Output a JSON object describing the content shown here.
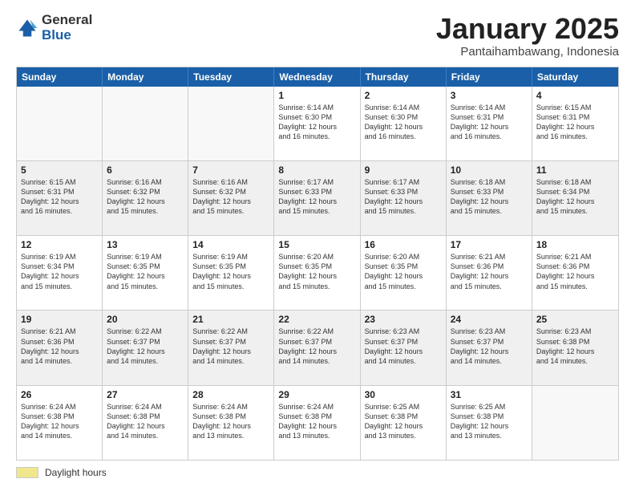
{
  "logo": {
    "general": "General",
    "blue": "Blue"
  },
  "title": "January 2025",
  "subtitle": "Pantaihambawang, Indonesia",
  "days": [
    "Sunday",
    "Monday",
    "Tuesday",
    "Wednesday",
    "Thursday",
    "Friday",
    "Saturday"
  ],
  "weeks": [
    [
      {
        "day": "",
        "info": ""
      },
      {
        "day": "",
        "info": ""
      },
      {
        "day": "",
        "info": ""
      },
      {
        "day": "1",
        "info": "Sunrise: 6:14 AM\nSunset: 6:30 PM\nDaylight: 12 hours\nand 16 minutes."
      },
      {
        "day": "2",
        "info": "Sunrise: 6:14 AM\nSunset: 6:30 PM\nDaylight: 12 hours\nand 16 minutes."
      },
      {
        "day": "3",
        "info": "Sunrise: 6:14 AM\nSunset: 6:31 PM\nDaylight: 12 hours\nand 16 minutes."
      },
      {
        "day": "4",
        "info": "Sunrise: 6:15 AM\nSunset: 6:31 PM\nDaylight: 12 hours\nand 16 minutes."
      }
    ],
    [
      {
        "day": "5",
        "info": "Sunrise: 6:15 AM\nSunset: 6:31 PM\nDaylight: 12 hours\nand 16 minutes."
      },
      {
        "day": "6",
        "info": "Sunrise: 6:16 AM\nSunset: 6:32 PM\nDaylight: 12 hours\nand 15 minutes."
      },
      {
        "day": "7",
        "info": "Sunrise: 6:16 AM\nSunset: 6:32 PM\nDaylight: 12 hours\nand 15 minutes."
      },
      {
        "day": "8",
        "info": "Sunrise: 6:17 AM\nSunset: 6:33 PM\nDaylight: 12 hours\nand 15 minutes."
      },
      {
        "day": "9",
        "info": "Sunrise: 6:17 AM\nSunset: 6:33 PM\nDaylight: 12 hours\nand 15 minutes."
      },
      {
        "day": "10",
        "info": "Sunrise: 6:18 AM\nSunset: 6:33 PM\nDaylight: 12 hours\nand 15 minutes."
      },
      {
        "day": "11",
        "info": "Sunrise: 6:18 AM\nSunset: 6:34 PM\nDaylight: 12 hours\nand 15 minutes."
      }
    ],
    [
      {
        "day": "12",
        "info": "Sunrise: 6:19 AM\nSunset: 6:34 PM\nDaylight: 12 hours\nand 15 minutes."
      },
      {
        "day": "13",
        "info": "Sunrise: 6:19 AM\nSunset: 6:35 PM\nDaylight: 12 hours\nand 15 minutes."
      },
      {
        "day": "14",
        "info": "Sunrise: 6:19 AM\nSunset: 6:35 PM\nDaylight: 12 hours\nand 15 minutes."
      },
      {
        "day": "15",
        "info": "Sunrise: 6:20 AM\nSunset: 6:35 PM\nDaylight: 12 hours\nand 15 minutes."
      },
      {
        "day": "16",
        "info": "Sunrise: 6:20 AM\nSunset: 6:35 PM\nDaylight: 12 hours\nand 15 minutes."
      },
      {
        "day": "17",
        "info": "Sunrise: 6:21 AM\nSunset: 6:36 PM\nDaylight: 12 hours\nand 15 minutes."
      },
      {
        "day": "18",
        "info": "Sunrise: 6:21 AM\nSunset: 6:36 PM\nDaylight: 12 hours\nand 15 minutes."
      }
    ],
    [
      {
        "day": "19",
        "info": "Sunrise: 6:21 AM\nSunset: 6:36 PM\nDaylight: 12 hours\nand 14 minutes."
      },
      {
        "day": "20",
        "info": "Sunrise: 6:22 AM\nSunset: 6:37 PM\nDaylight: 12 hours\nand 14 minutes."
      },
      {
        "day": "21",
        "info": "Sunrise: 6:22 AM\nSunset: 6:37 PM\nDaylight: 12 hours\nand 14 minutes."
      },
      {
        "day": "22",
        "info": "Sunrise: 6:22 AM\nSunset: 6:37 PM\nDaylight: 12 hours\nand 14 minutes."
      },
      {
        "day": "23",
        "info": "Sunrise: 6:23 AM\nSunset: 6:37 PM\nDaylight: 12 hours\nand 14 minutes."
      },
      {
        "day": "24",
        "info": "Sunrise: 6:23 AM\nSunset: 6:37 PM\nDaylight: 12 hours\nand 14 minutes."
      },
      {
        "day": "25",
        "info": "Sunrise: 6:23 AM\nSunset: 6:38 PM\nDaylight: 12 hours\nand 14 minutes."
      }
    ],
    [
      {
        "day": "26",
        "info": "Sunrise: 6:24 AM\nSunset: 6:38 PM\nDaylight: 12 hours\nand 14 minutes."
      },
      {
        "day": "27",
        "info": "Sunrise: 6:24 AM\nSunset: 6:38 PM\nDaylight: 12 hours\nand 14 minutes."
      },
      {
        "day": "28",
        "info": "Sunrise: 6:24 AM\nSunset: 6:38 PM\nDaylight: 12 hours\nand 13 minutes."
      },
      {
        "day": "29",
        "info": "Sunrise: 6:24 AM\nSunset: 6:38 PM\nDaylight: 12 hours\nand 13 minutes."
      },
      {
        "day": "30",
        "info": "Sunrise: 6:25 AM\nSunset: 6:38 PM\nDaylight: 12 hours\nand 13 minutes."
      },
      {
        "day": "31",
        "info": "Sunrise: 6:25 AM\nSunset: 6:38 PM\nDaylight: 12 hours\nand 13 minutes."
      },
      {
        "day": "",
        "info": ""
      }
    ]
  ],
  "footer": {
    "daylight_label": "Daylight hours"
  }
}
